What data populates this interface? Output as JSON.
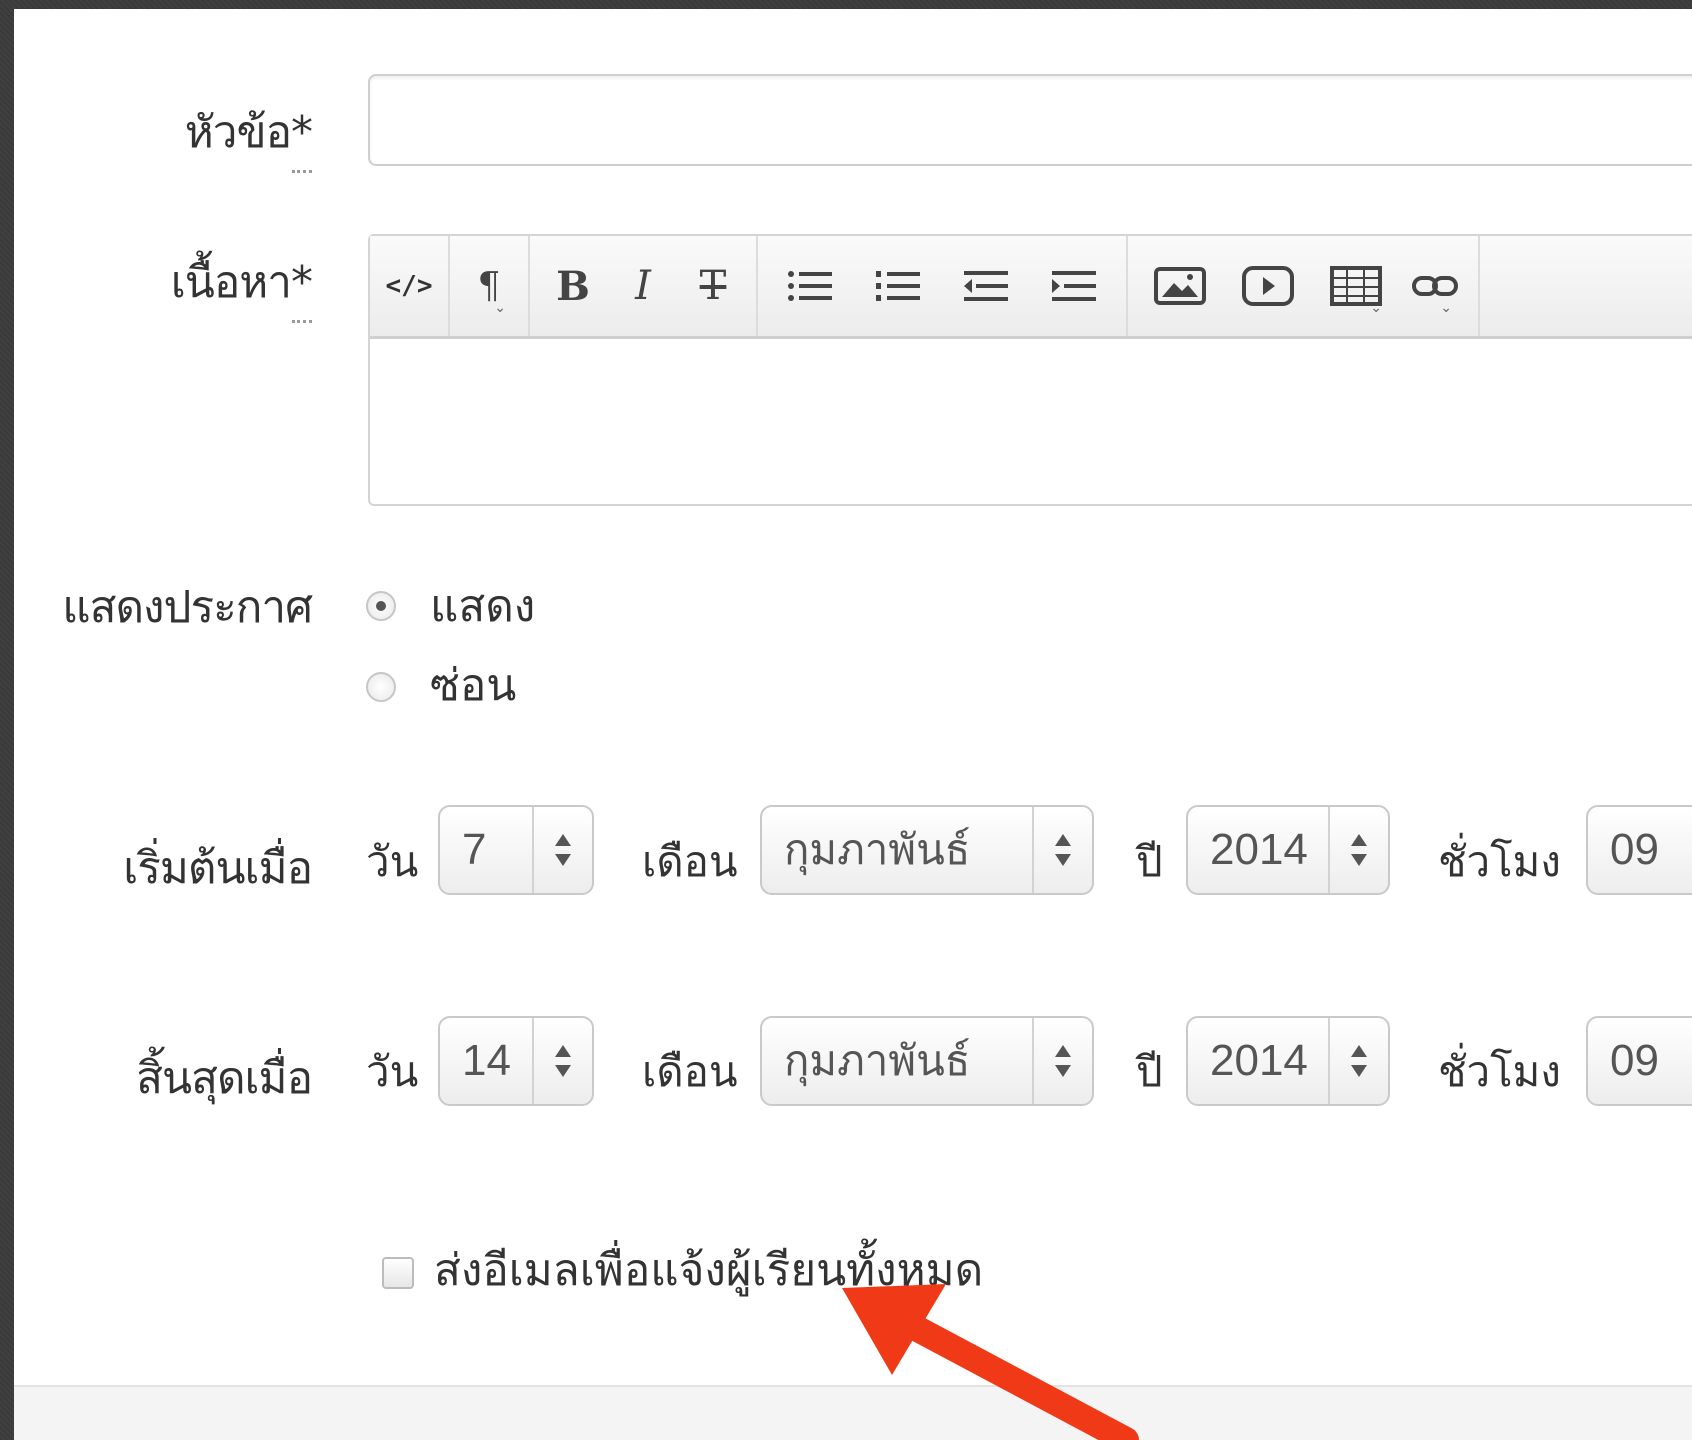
{
  "form": {
    "title_label": "หัวข้อ",
    "content_label": "เนื้อหา",
    "required_mark": "*",
    "title_value": "",
    "show_label": "แสดงประกาศ",
    "show_options": [
      "แสดง",
      "ซ่อน"
    ],
    "show_selected": "แสดง",
    "start_label": "เริ่มต้นเมื่อ",
    "end_label": "สิ้นสุดเมื่อ",
    "day_label": "วัน",
    "month_label": "เดือน",
    "year_label": "ปี",
    "hour_label": "ชั่วโมง",
    "start": {
      "day": "7",
      "month": "กุมภาพันธ์",
      "year": "2014",
      "hour": "09"
    },
    "end": {
      "day": "14",
      "month": "กุมภาพันธ์",
      "year": "2014",
      "hour": "09"
    },
    "email_checkbox_label": "ส่งอีเมลเพื่อแจ้งผู้เรียนทั้งหมด",
    "email_checked": false
  },
  "editor_toolbar": {
    "html_label": "</>",
    "paragraph_label": "¶",
    "bold_label": "B",
    "italic_label": "I",
    "strike_label": "T"
  },
  "colors": {
    "annotation_arrow": "#f03a17",
    "background": "#3b3b3b"
  }
}
